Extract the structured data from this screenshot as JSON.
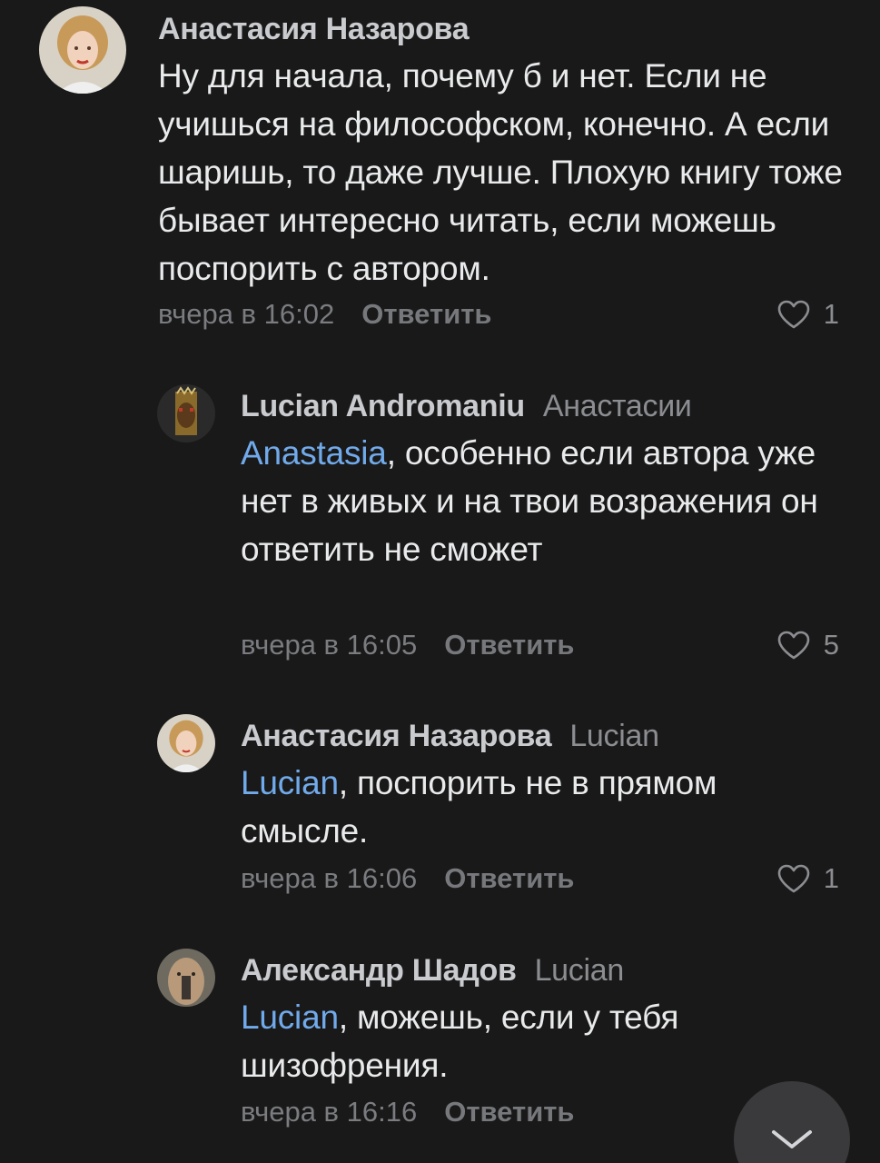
{
  "comments": [
    {
      "author": "Анастасия Назарова",
      "reply_to": "",
      "mention": "",
      "text": "Ну для начала, почему б и нет. Если не учишься на философском, конечно. А если шаришь, то даже лучше. Плохую книгу тоже бывает интересно читать, если можешь поспорить с автором.",
      "time": "вчера в 16:02",
      "reply_label": "Ответить",
      "likes": "1",
      "avatar": "woman-avatar"
    },
    {
      "author": "Lucian Andromaniu",
      "reply_to": "Анастасии",
      "mention": "Anastasia",
      "text": ", особенно если автора уже нет в живых и на твои возражения он ответить не сможет",
      "time": "вчера в 16:05",
      "reply_label": "Ответить",
      "likes": "5",
      "avatar": "icon-face-avatar"
    },
    {
      "author": "Анастасия Назарова",
      "reply_to": "Lucian",
      "mention": "Lucian",
      "text": ", поспорить не в прямом смысле.",
      "time": "вчера в 16:06",
      "reply_label": "Ответить",
      "likes": "1",
      "avatar": "woman-avatar"
    },
    {
      "author": "Александр Шадов",
      "reply_to": "Lucian",
      "mention": "Lucian",
      "text": ", можешь, если у тебя шизофрения.",
      "time": "вчера в 16:16",
      "reply_label": "Ответить",
      "likes": "",
      "avatar": "man-avatar"
    }
  ],
  "colors": {
    "background": "#191919",
    "mention": "#71aaeb",
    "author": "#c9cbcf",
    "meta": "#7a7c80"
  },
  "icons": {
    "like": "heart-icon",
    "scroll": "chevron-down-icon"
  }
}
